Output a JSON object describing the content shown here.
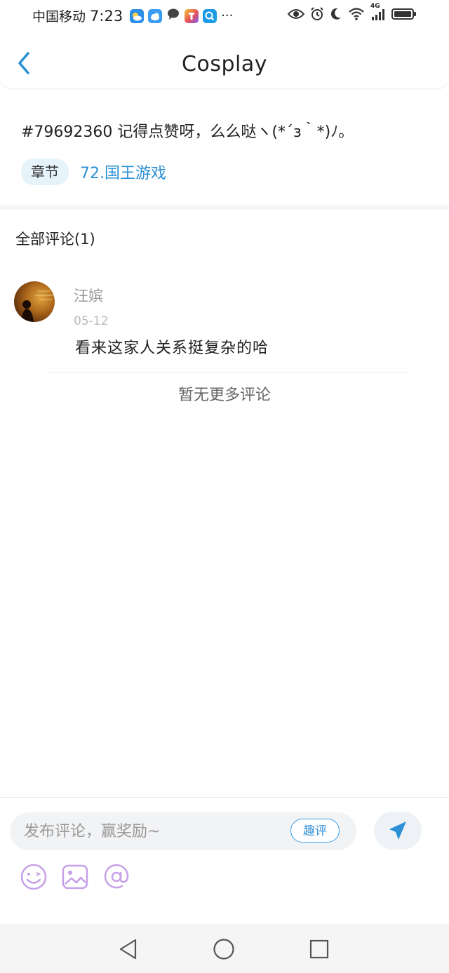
{
  "status_bar": {
    "carrier": "中国移动",
    "time": "7:23",
    "more": "···",
    "network": "4G"
  },
  "header": {
    "title": "Cosplay"
  },
  "post": {
    "text": "#79692360 记得点赞呀，么么哒ヽ(*´з｀*)ﾉ。",
    "chapter_tag": "章节",
    "chapter_link": "72.国王游戏"
  },
  "comments": {
    "title": "全部评论(1)",
    "items": [
      {
        "user": "汪嫔",
        "date": "05-12",
        "text": "看来这家人关系挺复杂的哈"
      }
    ],
    "no_more": "暂无更多评论"
  },
  "composer": {
    "placeholder": "发布评论，赢奖励~",
    "quping_label": "趣评"
  },
  "colors": {
    "accent": "#2a8fd4",
    "tool_icon": "#c6a0e8",
    "chapter_tag_bg": "#e6f3fb"
  },
  "icons": {
    "back": "chevron-left-icon",
    "send": "paper-plane-icon",
    "emoji": "emoji-icon",
    "image": "image-icon",
    "mention": "at-icon",
    "nav_back": "triangle-back-icon",
    "nav_home": "circle-home-icon",
    "nav_recents": "square-recents-icon"
  }
}
